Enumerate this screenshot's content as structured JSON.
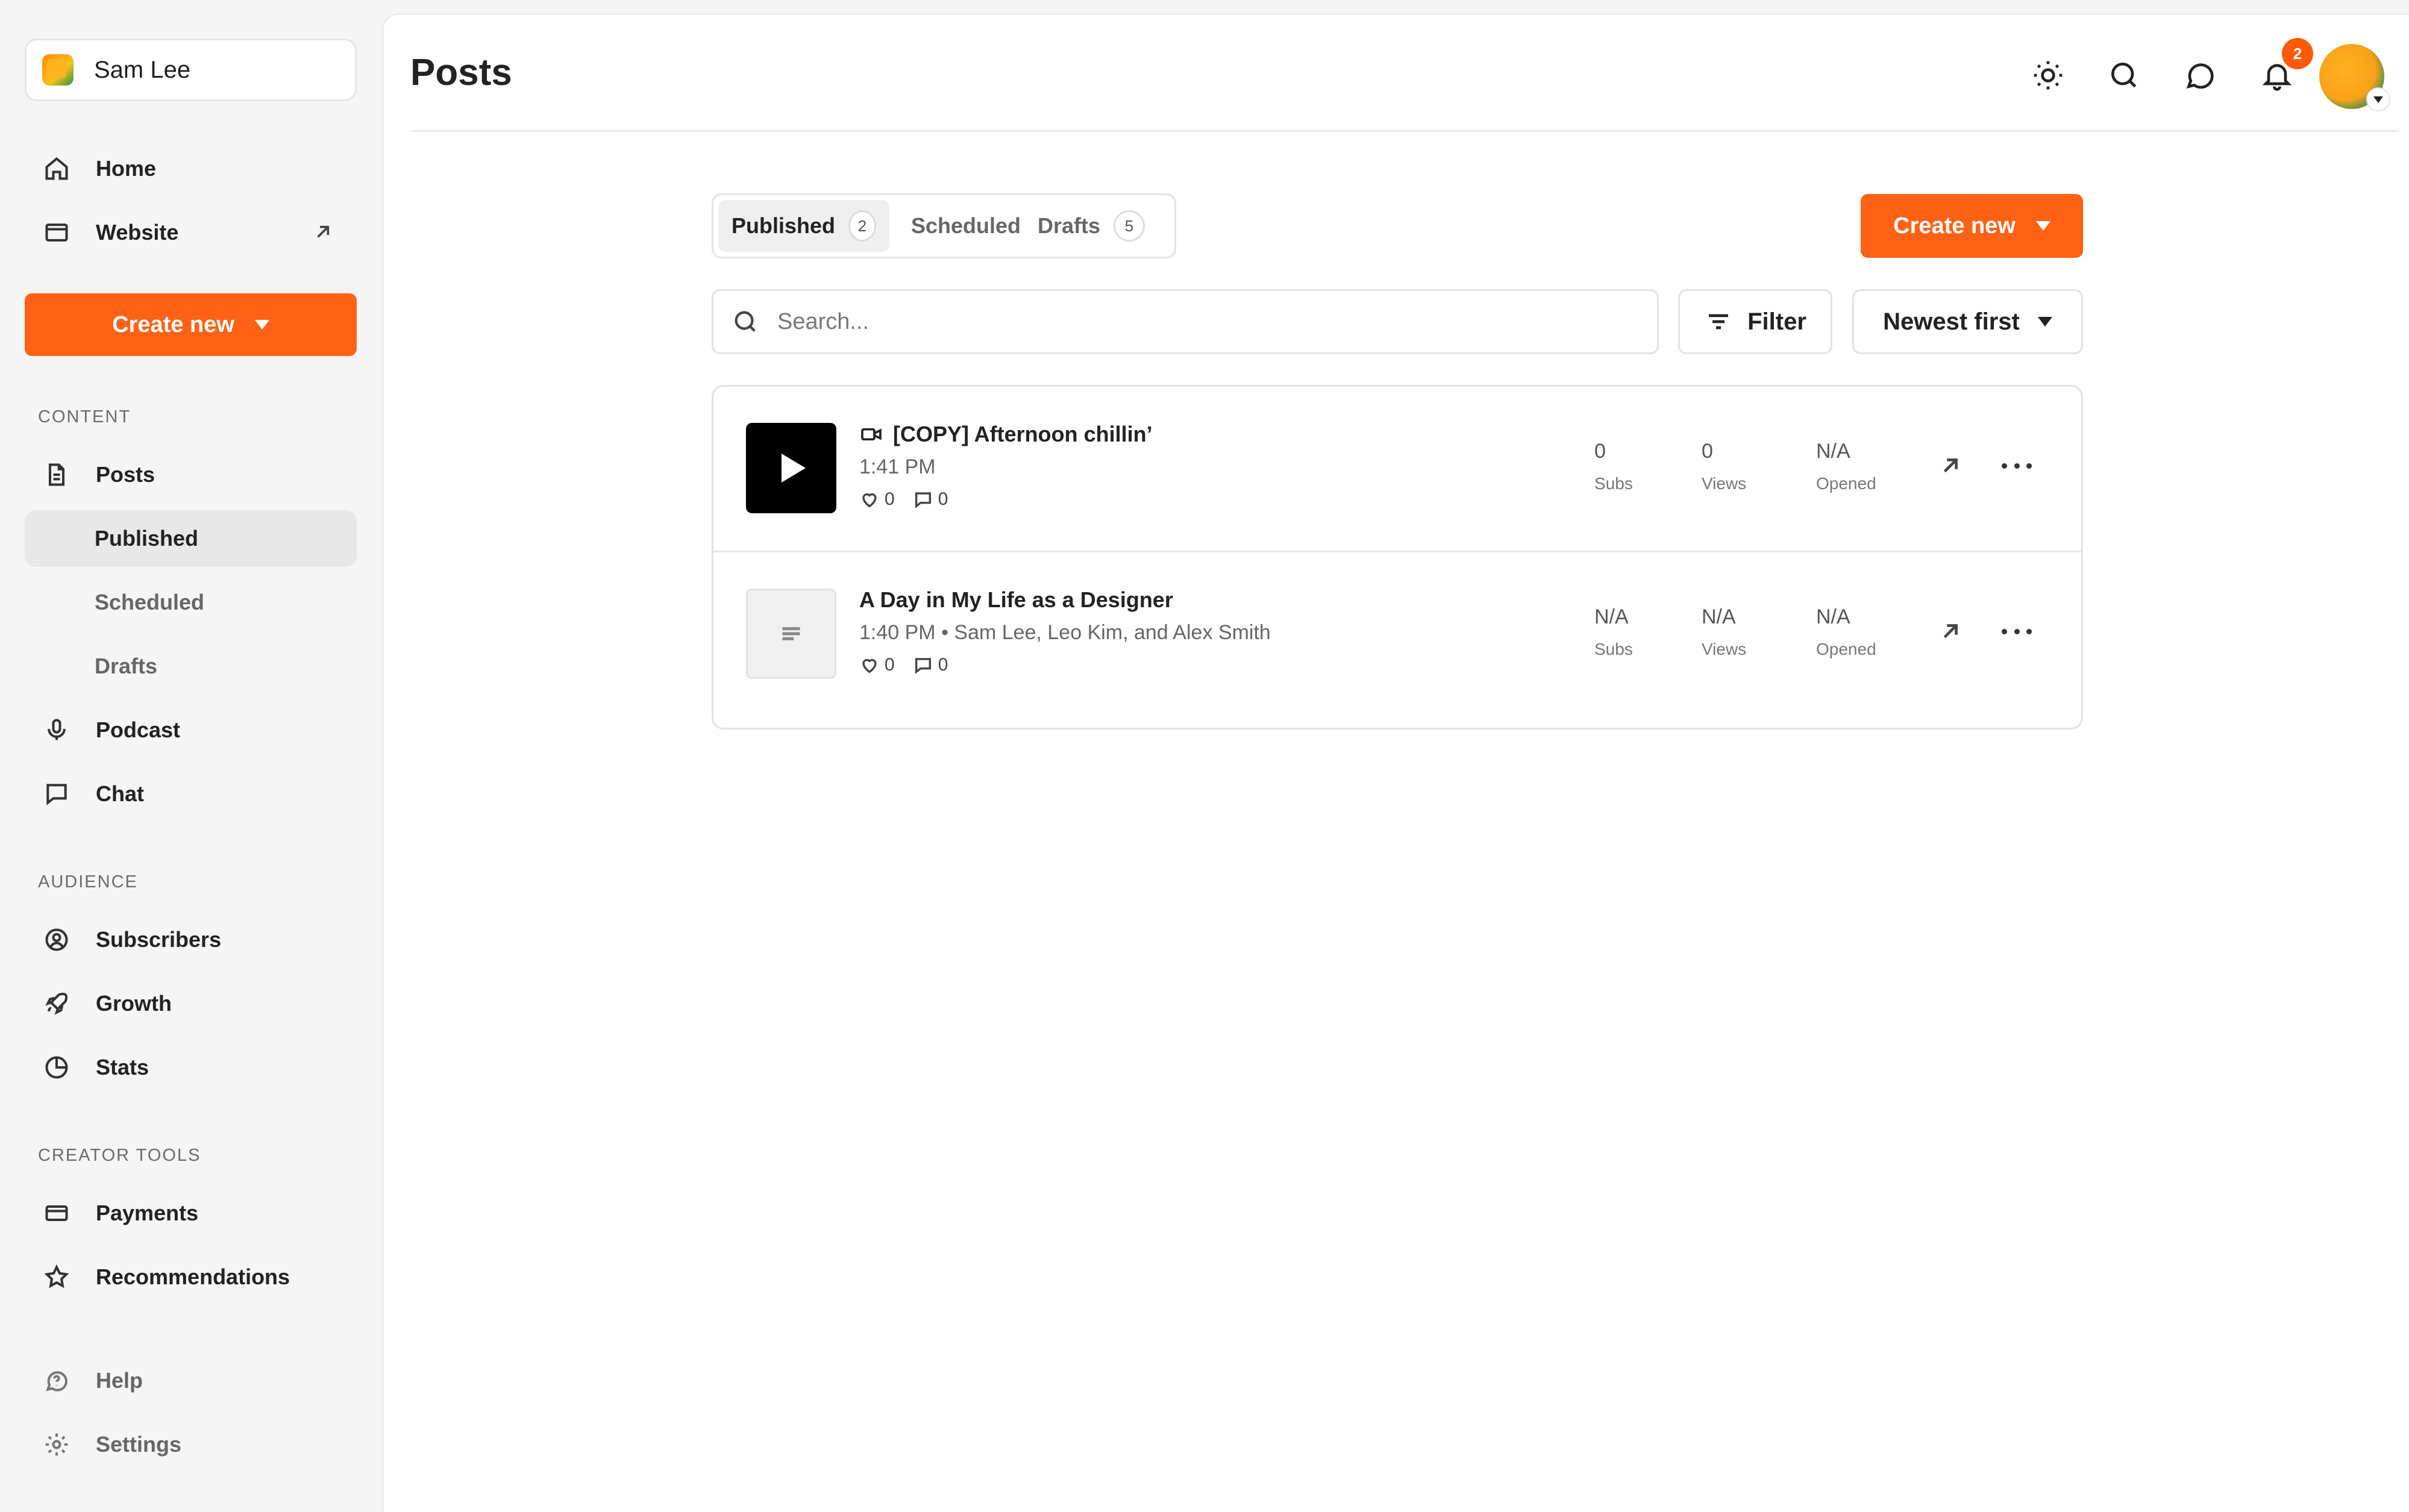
{
  "account": {
    "name": "Sam Lee"
  },
  "nav": {
    "home": "Home",
    "website": "Website",
    "create_new": "Create new",
    "content_label": "CONTENT",
    "posts": "Posts",
    "published": "Published",
    "scheduled": "Scheduled",
    "drafts": "Drafts",
    "podcast": "Podcast",
    "chat": "Chat",
    "audience_label": "AUDIENCE",
    "subscribers": "Subscribers",
    "growth": "Growth",
    "stats": "Stats",
    "creator_tools_label": "CREATOR TOOLS",
    "payments": "Payments",
    "recommendations": "Recommendations",
    "help": "Help",
    "settings": "Settings"
  },
  "header": {
    "title": "Posts",
    "notification_count": "2",
    "icons": [
      "sun-icon",
      "search-icon",
      "chat-bubble-icon",
      "bell-icon"
    ]
  },
  "tabs": [
    {
      "label": "Published",
      "count": "2",
      "active": true
    },
    {
      "label": "Scheduled",
      "count": "",
      "active": false
    },
    {
      "label": "Drafts",
      "count": "5",
      "active": false
    }
  ],
  "toolbar": {
    "create_new": "Create new",
    "search_placeholder": "Search...",
    "filter": "Filter",
    "sort": "Newest first"
  },
  "posts": [
    {
      "title": "[COPY] Afternoon chillin’",
      "meta": "1:41 PM",
      "type": "video",
      "likes": "0",
      "comments": "0",
      "subs": "0",
      "views": "0",
      "opened": "N/A"
    },
    {
      "title": "A Day in My Life as a Designer",
      "meta": "1:40 PM • Sam Lee, Leo Kim, and Alex Smith",
      "type": "text",
      "likes": "0",
      "comments": "0",
      "subs": "N/A",
      "views": "N/A",
      "opened": "N/A"
    }
  ],
  "metric_labels": {
    "subs": "Subs",
    "views": "Views",
    "opened": "Opened"
  },
  "colors": {
    "accent": "#ff6214",
    "badge": "#ff5a0a"
  }
}
